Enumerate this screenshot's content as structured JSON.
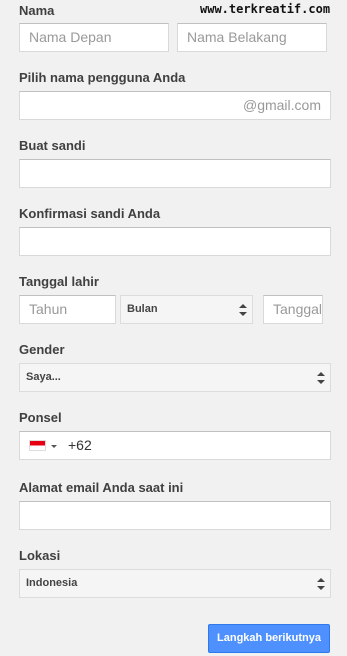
{
  "watermark": "www.terkreatif.com",
  "name": {
    "label": "Nama",
    "first_placeholder": "Nama Depan",
    "last_placeholder": "Nama Belakang"
  },
  "username": {
    "label": "Pilih nama pengguna Anda",
    "suffix": "@gmail.com"
  },
  "password": {
    "label": "Buat sandi"
  },
  "confirm_password": {
    "label": "Konfirmasi sandi Anda"
  },
  "birthdate": {
    "label": "Tanggal lahir",
    "year_placeholder": "Tahun",
    "month_value": "Bulan",
    "day_placeholder": "Tanggal"
  },
  "gender": {
    "label": "Gender",
    "value": "Saya..."
  },
  "phone": {
    "label": "Ponsel",
    "country": "Indonesia",
    "code": "+62",
    "flag_colors": [
      "#e70011",
      "#ffffff"
    ]
  },
  "current_email": {
    "label": "Alamat email Anda saat ini"
  },
  "location": {
    "label": "Lokasi",
    "value": "Indonesia"
  },
  "next_button": "Langkah berikutnya",
  "colors": {
    "accent": "#4d90fe",
    "background": "#f1f1f1"
  }
}
